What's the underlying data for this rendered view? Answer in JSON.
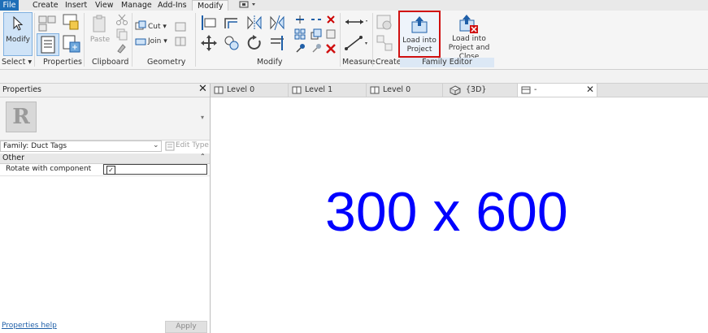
{
  "menu_tabs": [
    "File",
    "Create",
    "Insert",
    "View",
    "Manage",
    "Add-Ins",
    "Modify"
  ],
  "ribbon": {
    "panels": [
      "Select",
      "Properties",
      "Clipboard",
      "Geometry",
      "Modify",
      "Measure",
      "Create",
      "Family Editor"
    ],
    "modify_label": "Modify",
    "paste_label": "Paste",
    "cut_label": "Cut",
    "join_label": "Join",
    "load_into_project": "Load into\nProject",
    "load_into_project_close": "Load into\nProject and Close"
  },
  "properties": {
    "title": "Properties",
    "type_selector": "Family: Duct Tags",
    "edit_type": "Edit Type",
    "group": "Other",
    "rows": [
      {
        "name": "Rotate with component",
        "checked": true
      }
    ],
    "help_link": "Properties help",
    "apply": "Apply"
  },
  "view_tabs": [
    "Level 0",
    "Level 1",
    "Level 0",
    "{3D}",
    "-"
  ],
  "canvas_text": "300 x 600",
  "colors": {
    "file_tab": "#1f6fb8",
    "canvas_text": "#0000ff",
    "highlight": "#d01010"
  }
}
